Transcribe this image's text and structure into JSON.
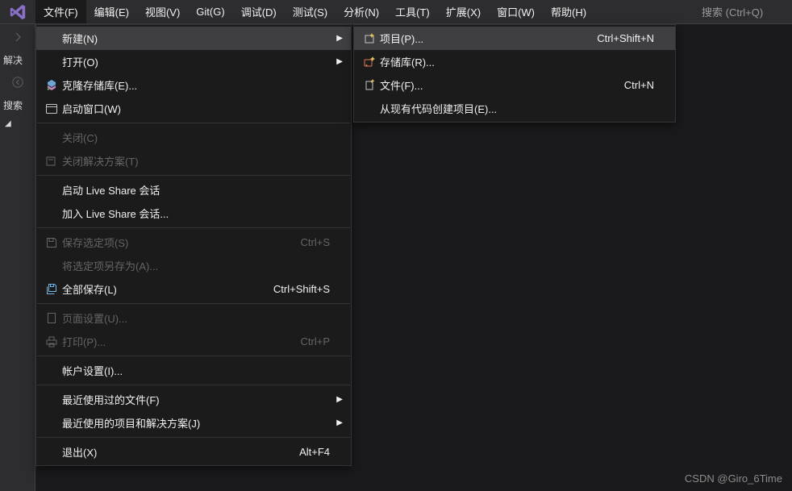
{
  "menubar": {
    "items": [
      "文件(F)",
      "编辑(E)",
      "视图(V)",
      "Git(G)",
      "调试(D)",
      "测试(S)",
      "分析(N)",
      "工具(T)",
      "扩展(X)",
      "窗口(W)",
      "帮助(H)"
    ],
    "open_index": 0
  },
  "search": {
    "placeholder": "搜索 (Ctrl+Q)"
  },
  "left_rail": {
    "solution_label": "解决",
    "search_label": "搜索"
  },
  "file_menu": {
    "items": [
      {
        "label": "新建(N)",
        "shortcut": "",
        "submenu": true,
        "hover": true
      },
      {
        "label": "打开(O)",
        "shortcut": "",
        "submenu": true
      },
      {
        "label": "克隆存储库(E)...",
        "shortcut": "",
        "icon": "clone"
      },
      {
        "label": "启动窗口(W)",
        "shortcut": "",
        "icon": "window"
      },
      {
        "sep": true
      },
      {
        "label": "关闭(C)",
        "shortcut": "",
        "disabled": true
      },
      {
        "label": "关闭解决方案(T)",
        "shortcut": "",
        "icon": "close-sln",
        "disabled": true
      },
      {
        "sep": true
      },
      {
        "label": "启动 Live Share 会话",
        "shortcut": ""
      },
      {
        "label": "加入 Live Share 会话...",
        "shortcut": ""
      },
      {
        "sep": true
      },
      {
        "label": "保存选定项(S)",
        "shortcut": "Ctrl+S",
        "icon": "save",
        "disabled": true
      },
      {
        "label": "将选定项另存为(A)...",
        "shortcut": "",
        "disabled": true
      },
      {
        "label": "全部保存(L)",
        "shortcut": "Ctrl+Shift+S",
        "icon": "save-all"
      },
      {
        "sep": true
      },
      {
        "label": "页面设置(U)...",
        "shortcut": "",
        "icon": "page-setup",
        "disabled": true
      },
      {
        "label": "打印(P)...",
        "shortcut": "Ctrl+P",
        "icon": "print",
        "disabled": true
      },
      {
        "sep": true
      },
      {
        "label": "帐户设置(I)...",
        "shortcut": ""
      },
      {
        "sep": true
      },
      {
        "label": "最近使用过的文件(F)",
        "shortcut": "",
        "submenu": true
      },
      {
        "label": "最近使用的项目和解决方案(J)",
        "shortcut": "",
        "submenu": true
      },
      {
        "sep": true
      },
      {
        "label": "退出(X)",
        "shortcut": "Alt+F4"
      }
    ]
  },
  "new_menu": {
    "items": [
      {
        "label": "项目(P)...",
        "shortcut": "Ctrl+Shift+N",
        "icon": "project",
        "hover": true
      },
      {
        "label": "存储库(R)...",
        "shortcut": "",
        "icon": "repo"
      },
      {
        "label": "文件(F)...",
        "shortcut": "Ctrl+N",
        "icon": "file"
      },
      {
        "label": "从现有代码创建项目(E)...",
        "shortcut": ""
      }
    ]
  },
  "watermark": "CSDN @Giro_6Time"
}
